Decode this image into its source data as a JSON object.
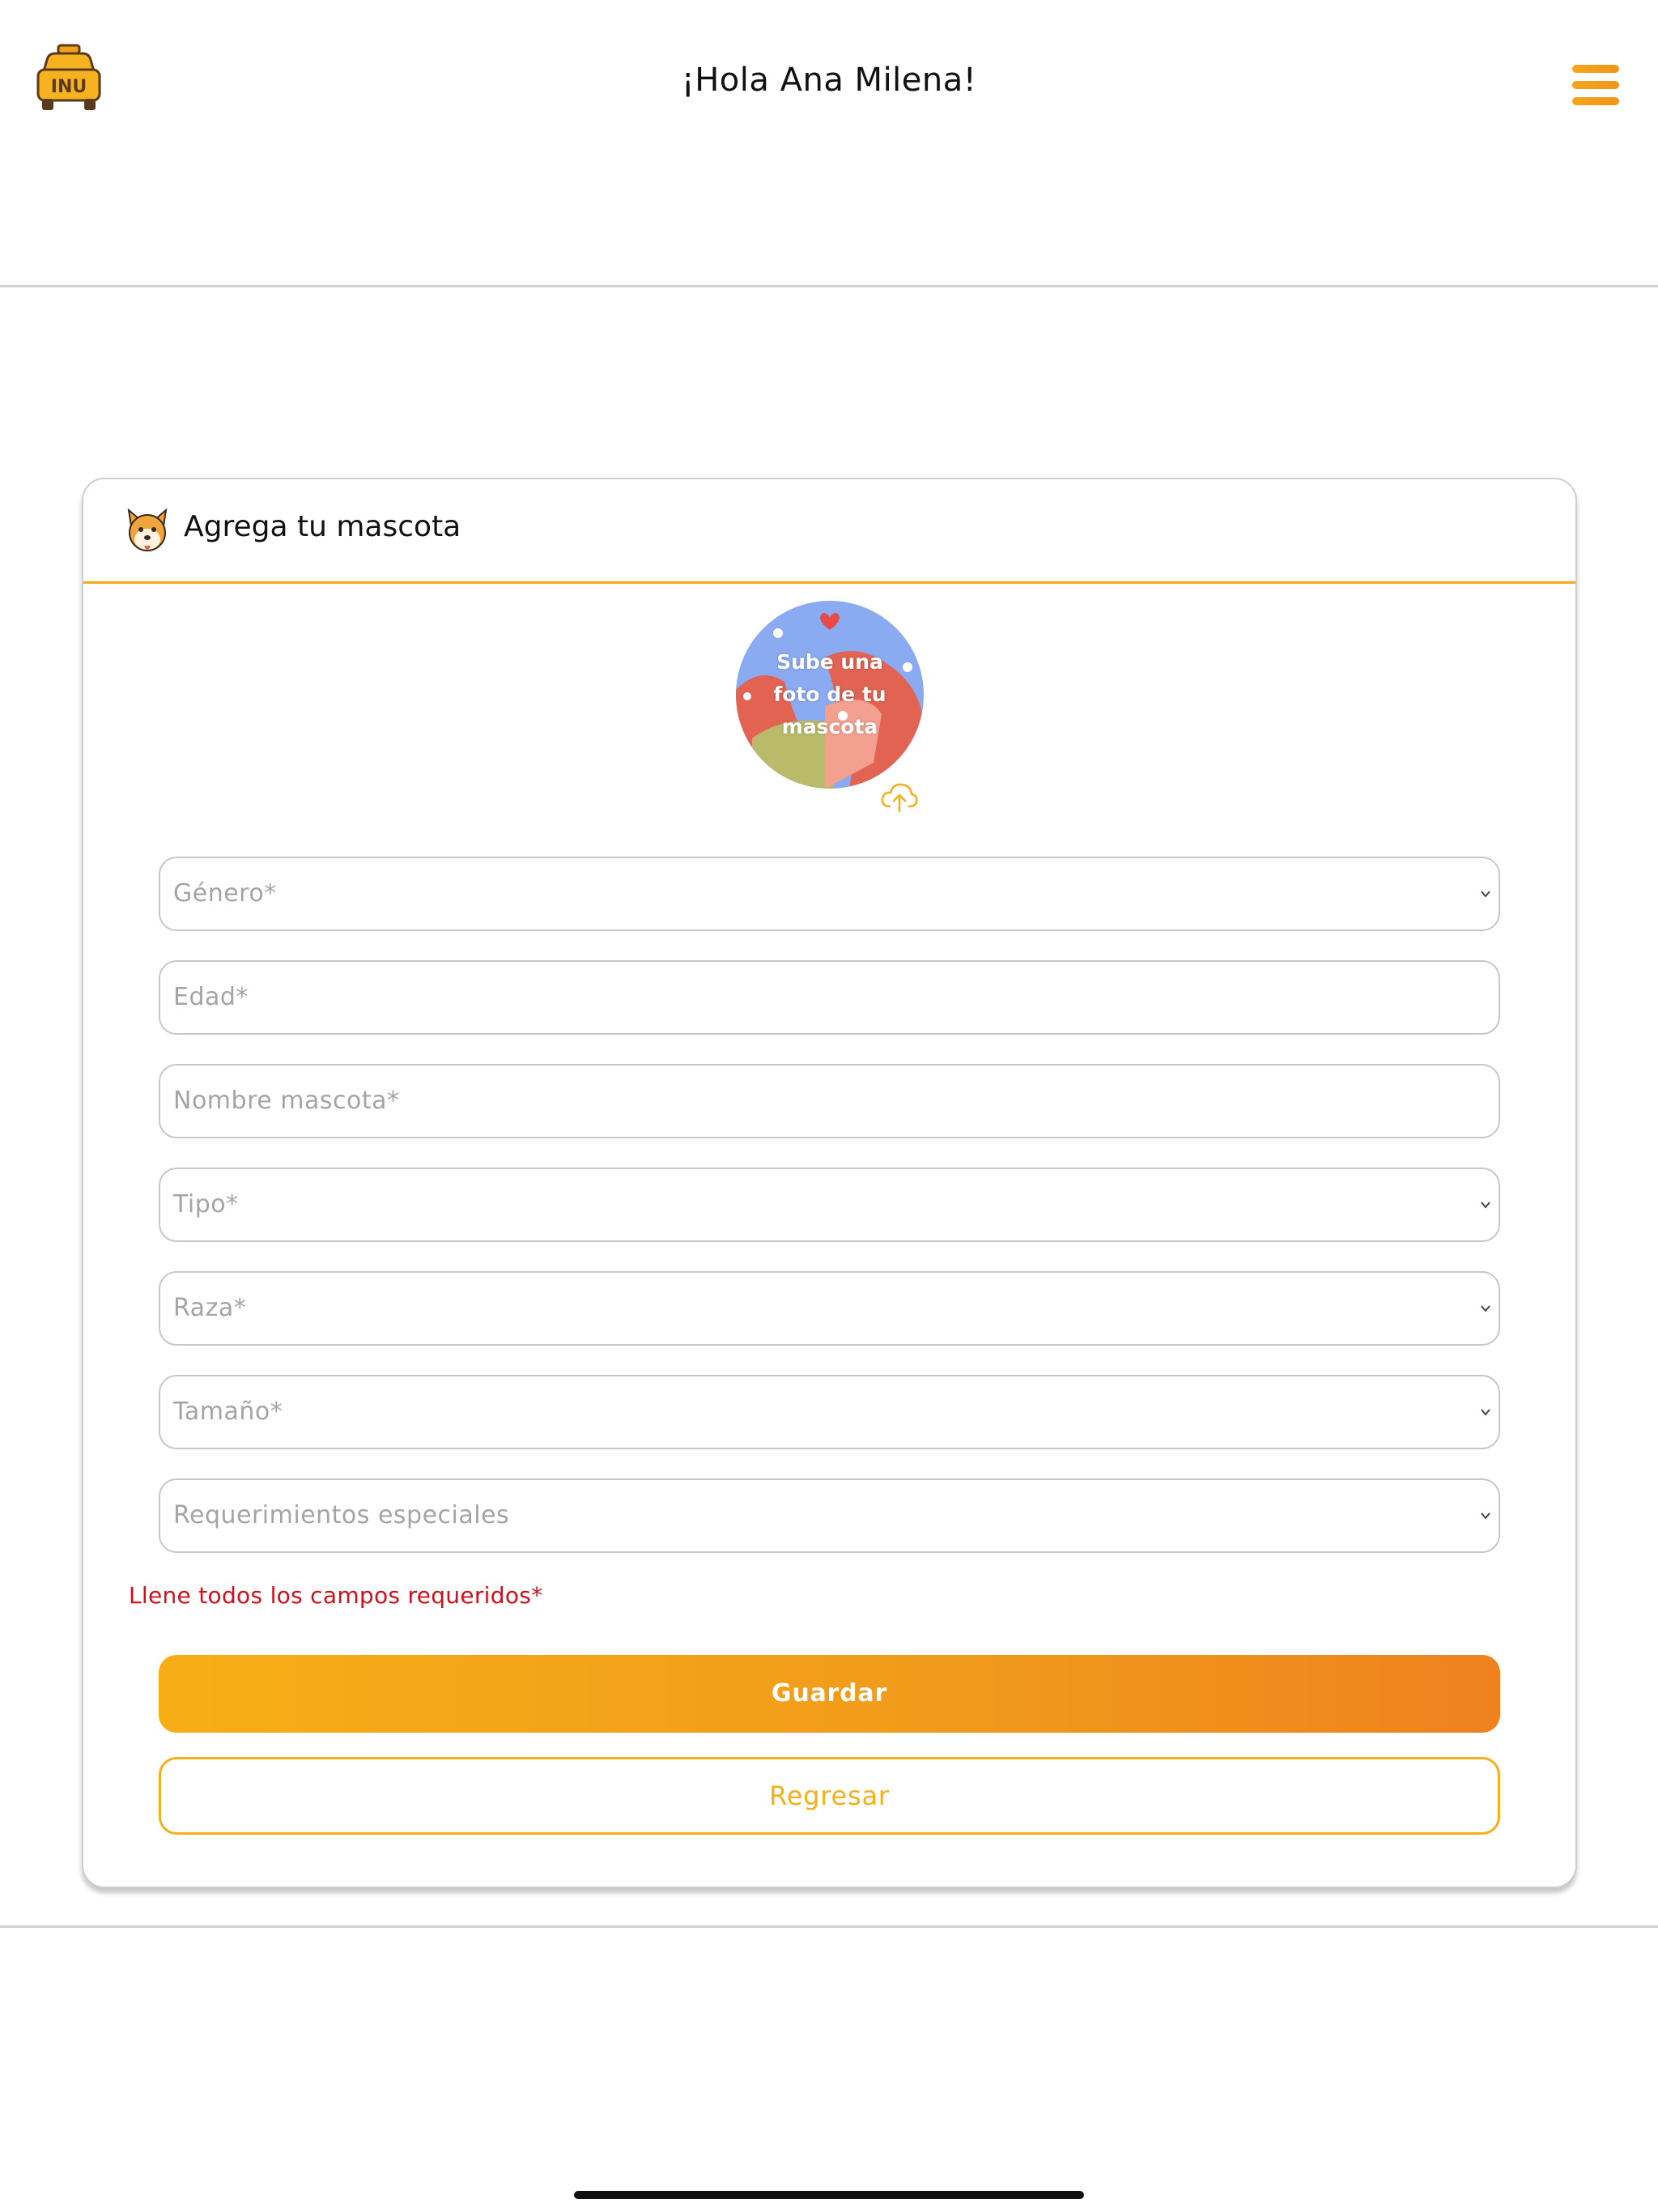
{
  "header": {
    "logo_text": "INU",
    "greeting": "¡Hola Ana Milena!",
    "menu_icon": "hamburger-menu-icon"
  },
  "form": {
    "title": "Agrega tu mascota",
    "title_icon": "dog-face-icon",
    "photo_prompt": "Sube una foto de tu mascota",
    "upload_icon": "cloud-upload-icon",
    "fields": [
      {
        "placeholder": "Género*",
        "type": "select"
      },
      {
        "placeholder": "Edad*",
        "type": "input"
      },
      {
        "placeholder": "Nombre mascota*",
        "type": "input"
      },
      {
        "placeholder": "Tipo*",
        "type": "select"
      },
      {
        "placeholder": "Raza*",
        "type": "select"
      },
      {
        "placeholder": "Tamaño*",
        "type": "select"
      },
      {
        "placeholder": "Requerimientos especiales",
        "type": "select"
      }
    ],
    "error_message": "Llene todos los campos requeridos*",
    "save_label": "Guardar",
    "back_label": "Regresar"
  },
  "colors": {
    "accent": "#f4b01b",
    "accent_dark": "#ef821e",
    "error": "#d0101c",
    "border": "#c7c7c7"
  }
}
